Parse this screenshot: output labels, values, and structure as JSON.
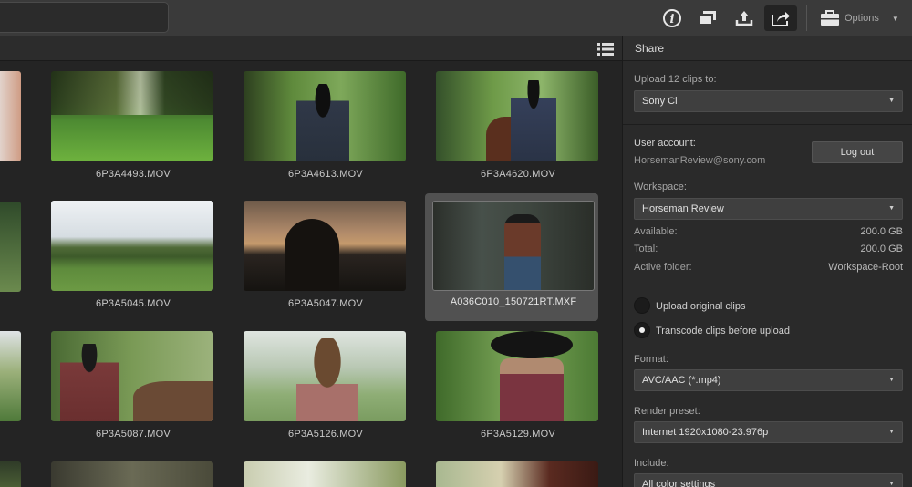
{
  "toolbar": {
    "options_label": "Options",
    "buttons": [
      "info-icon",
      "copy-window-icon",
      "upload-icon",
      "share-icon",
      "briefcase-icon"
    ]
  },
  "clips": [
    {
      "name": "6P3A4493.MOV",
      "selected": false
    },
    {
      "name": "6P3A4613.MOV",
      "selected": false
    },
    {
      "name": "6P3A4620.MOV",
      "selected": false
    },
    {
      "name": "6P3A5045.MOV",
      "selected": false
    },
    {
      "name": "6P3A5047.MOV",
      "selected": false
    },
    {
      "name": "A036C010_150721RT.MXF",
      "selected": true
    },
    {
      "name": "6P3A5087.MOV",
      "selected": false
    },
    {
      "name": "6P3A5126.MOV",
      "selected": false
    },
    {
      "name": "6P3A5129.MOV",
      "selected": false
    }
  ],
  "panel": {
    "title": "Share",
    "upload_label": "Upload 12 clips to:",
    "upload_target": "Sony Ci",
    "user_account_label": "User account:",
    "user_account_value": "HorsemanReview@sony.com",
    "logout_label": "Log out",
    "workspace_label": "Workspace:",
    "workspace_value": "Horseman Review",
    "available_label": "Available:",
    "available_value": "200.0 GB",
    "total_label": "Total:",
    "total_value": "200.0 GB",
    "active_folder_label": "Active folder:",
    "active_folder_value": "Workspace-Root",
    "radio_original": "Upload original clips",
    "radio_transcode": "Transcode clips before upload",
    "radio_selected": "transcode",
    "format_label": "Format:",
    "format_value": "AVC/AAC (*.mp4)",
    "render_preset_label": "Render preset:",
    "render_preset_value": "Internet 1920x1080-23.976p",
    "include_label": "Include:",
    "include_value": "All color settings"
  },
  "colors": {
    "toolbar_bg": "#3a3a3a",
    "grid_bg": "#242424",
    "panel_bg": "#2a2a2a",
    "selected_tile": "#515151"
  }
}
